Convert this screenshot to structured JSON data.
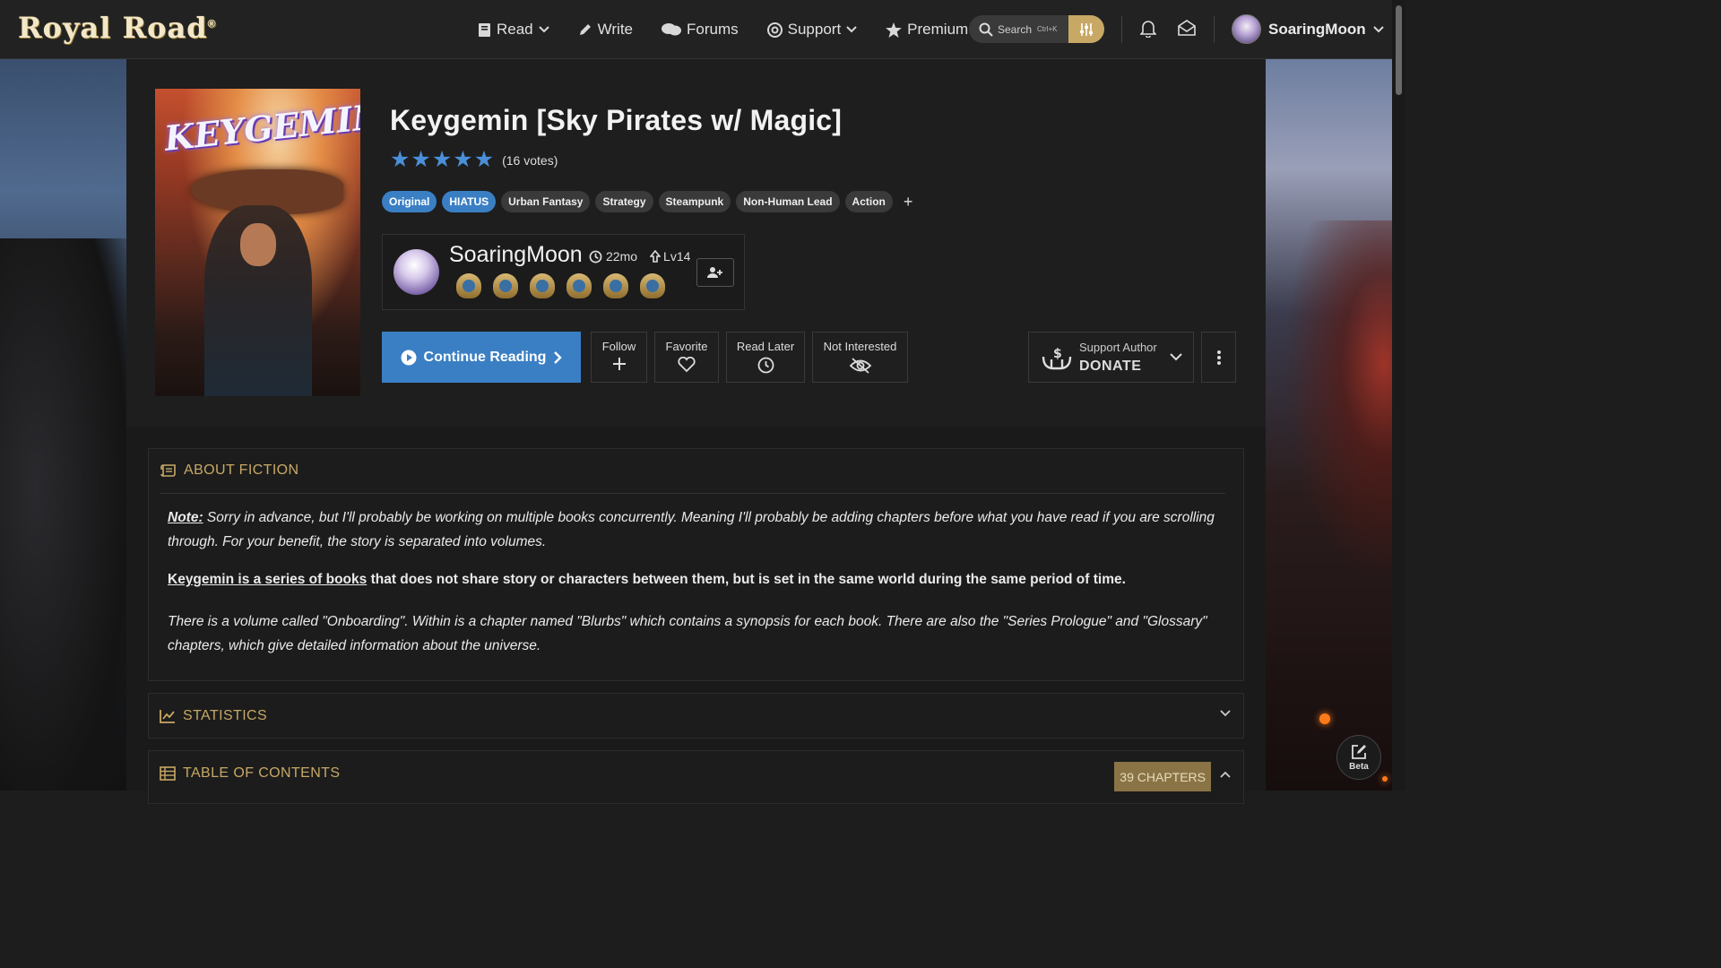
{
  "site": {
    "logo": "Royal Road",
    "logo_mark": "®"
  },
  "nav": {
    "items": [
      {
        "label": "Read",
        "icon": "book-icon",
        "has_dropdown": true
      },
      {
        "label": "Write",
        "icon": "pencil-icon",
        "has_dropdown": false
      },
      {
        "label": "Forums",
        "icon": "comments-icon",
        "has_dropdown": false
      },
      {
        "label": "Support",
        "icon": "lifebuoy-icon",
        "has_dropdown": true
      },
      {
        "label": "Premium",
        "icon": "star-icon",
        "has_dropdown": false
      }
    ],
    "search_label": "Search",
    "search_shortcut": "Ctrl+K",
    "user": "SoaringMoon"
  },
  "fiction": {
    "title": "Keygemin [Sky Pirates w/ Magic]",
    "cover_title": "KEYGEMIN",
    "stars": 5,
    "votes": "(16 votes)",
    "tags": [
      {
        "label": "Original",
        "style": "blue"
      },
      {
        "label": "HIATUS",
        "style": "blue"
      },
      {
        "label": "Urban Fantasy",
        "style": "grey"
      },
      {
        "label": "Strategy",
        "style": "grey"
      },
      {
        "label": "Steampunk",
        "style": "grey"
      },
      {
        "label": "Non-Human Lead",
        "style": "grey"
      },
      {
        "label": "Action",
        "style": "grey"
      }
    ],
    "tag_add": "+"
  },
  "author": {
    "name": "SoaringMoon",
    "age": "22mo",
    "level": "Lv14",
    "badge_count": 6
  },
  "actions": {
    "continue": "Continue Reading",
    "follow": "Follow",
    "favorite": "Favorite",
    "read_later": "Read Later",
    "not_interested": "Not Interested",
    "support_label": "Support Author",
    "donate": "DONATE"
  },
  "about": {
    "heading": "ABOUT FICTION",
    "note_label": "Note:",
    "note_text": " Sorry in advance, but I'll probably be working on multiple books concurrently. Meaning I'll probably be adding chapters before what you have read if you are scrolling through. For your benefit, the story is separated into volumes.",
    "link_text": "Keygemin is a series of books",
    "p2_rest": " that does not share story or characters between them, but is set in the same world during the same period of time.",
    "p3": "There is a volume called \"Onboarding\". Within is a chapter named \"Blurbs\" which contains a synopsis for each book. There are also the \"Series Prologue\" and \"Glossary\" chapters, which give detailed information about the universe."
  },
  "statistics": {
    "heading": "STATISTICS"
  },
  "toc": {
    "heading": "TABLE OF CONTENTS",
    "count": "39 CHAPTERS"
  },
  "beta": {
    "label": "Beta"
  },
  "colors": {
    "accent": "#3a7fc4",
    "gold": "#c7a865",
    "bg": "#1a1a1a"
  }
}
